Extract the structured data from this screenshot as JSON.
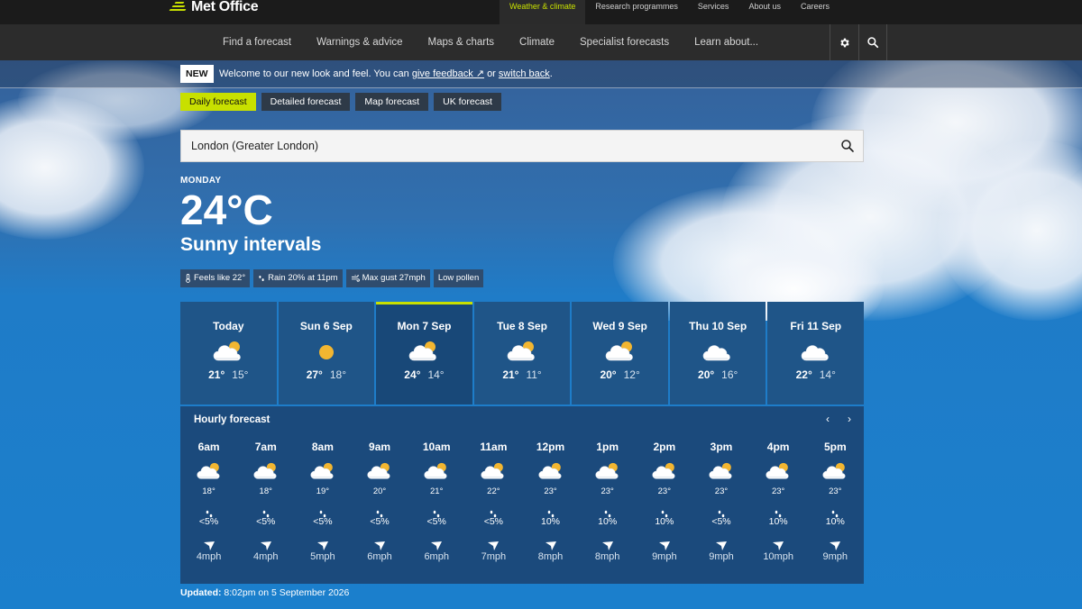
{
  "brand": {
    "name": "Met Office"
  },
  "top_links": [
    "Weather & climate",
    "Research programmes",
    "Services",
    "About us",
    "Careers"
  ],
  "main_nav": [
    "Find a forecast",
    "Warnings & advice",
    "Maps & charts",
    "Climate",
    "Specialist forecasts",
    "Learn about..."
  ],
  "icons": {
    "settings": "gear-icon",
    "search": "search-icon"
  },
  "banner": {
    "badge": "NEW",
    "text": "Welcome to our new look and feel. You can",
    "feedback_link": "give feedback ↗",
    "or_text": "or",
    "switch_link": "switch back",
    "end": "."
  },
  "tabs": [
    "Daily forecast",
    "Detailed forecast",
    "Map forecast",
    "UK forecast"
  ],
  "search": {
    "value": "London (Greater London)"
  },
  "current": {
    "day": "MONDAY",
    "temperature": "24°C",
    "condition": "Sunny intervals",
    "chips": [
      {
        "icon": "thermometer-icon",
        "text": "Feels like 22°"
      },
      {
        "icon": "rain-icon",
        "text": "Rain 20% at 11pm"
      },
      {
        "icon": "wind-icon",
        "text": "Max gust 27mph"
      },
      {
        "icon": "",
        "text": "Low pollen"
      }
    ]
  },
  "days": [
    {
      "name": "Today",
      "icon": "sunny-intervals-icon",
      "high": "21°",
      "low": "15°",
      "selected": false
    },
    {
      "name": "Sun 6 Sep",
      "icon": "sun-icon",
      "high": "27°",
      "low": "18°",
      "selected": false
    },
    {
      "name": "Mon 7 Sep",
      "icon": "sunny-intervals-icon",
      "high": "24°",
      "low": "14°",
      "selected": true
    },
    {
      "name": "Tue 8 Sep",
      "icon": "sunny-intervals-icon",
      "high": "21°",
      "low": "11°",
      "selected": false
    },
    {
      "name": "Wed 9 Sep",
      "icon": "sunny-intervals-icon",
      "high": "20°",
      "low": "12°",
      "selected": false
    },
    {
      "name": "Thu 10 Sep",
      "icon": "cloud-icon",
      "high": "20°",
      "low": "16°",
      "selected": false
    },
    {
      "name": "Fri 11 Sep",
      "icon": "cloud-icon",
      "high": "22°",
      "low": "14°",
      "selected": false
    }
  ],
  "hourly": {
    "title": "Hourly forecast",
    "prev": "‹",
    "next": "›",
    "hours": [
      {
        "time": "6am",
        "temp": "18°",
        "rain": "<5%",
        "wind": "4mph"
      },
      {
        "time": "7am",
        "temp": "18°",
        "rain": "<5%",
        "wind": "4mph"
      },
      {
        "time": "8am",
        "temp": "19°",
        "rain": "<5%",
        "wind": "5mph"
      },
      {
        "time": "9am",
        "temp": "20°",
        "rain": "<5%",
        "wind": "6mph"
      },
      {
        "time": "10am",
        "temp": "21°",
        "rain": "<5%",
        "wind": "6mph"
      },
      {
        "time": "11am",
        "temp": "22°",
        "rain": "<5%",
        "wind": "7mph"
      },
      {
        "time": "12pm",
        "temp": "23°",
        "rain": "10%",
        "wind": "8mph"
      },
      {
        "time": "1pm",
        "temp": "23°",
        "rain": "10%",
        "wind": "8mph"
      },
      {
        "time": "2pm",
        "temp": "23°",
        "rain": "10%",
        "wind": "9mph"
      },
      {
        "time": "3pm",
        "temp": "23°",
        "rain": "<5%",
        "wind": "9mph"
      },
      {
        "time": "4pm",
        "temp": "23°",
        "rain": "10%",
        "wind": "10mph"
      },
      {
        "time": "5pm",
        "temp": "23°",
        "rain": "10%",
        "wind": "9mph"
      }
    ]
  },
  "updated": {
    "label": "Updated:",
    "text": "8:02pm on 5 September 2026"
  },
  "colors": {
    "accent": "#c8e000",
    "card": "#1f5588",
    "hourly_bg": "#1b4a7c",
    "sun": "#f2b631"
  }
}
